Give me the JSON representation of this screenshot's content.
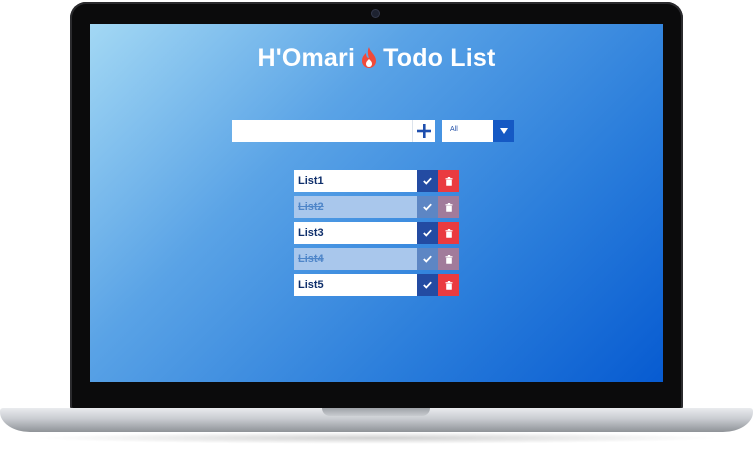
{
  "app": {
    "title_left": "H'Omari",
    "title_right": "Todo List",
    "flame_icon": "flame-icon",
    "accent_color": "#1559c4",
    "delete_color": "#ea3b40"
  },
  "input": {
    "value": "",
    "placeholder": "",
    "add_icon": "plus-icon"
  },
  "filter": {
    "selected": "All",
    "arrow_icon": "caret-down-icon"
  },
  "todos": [
    {
      "text": "List1",
      "completed": false
    },
    {
      "text": "List2",
      "completed": true
    },
    {
      "text": "List3",
      "completed": false
    },
    {
      "text": "List4",
      "completed": true
    },
    {
      "text": "List5",
      "completed": false
    }
  ]
}
